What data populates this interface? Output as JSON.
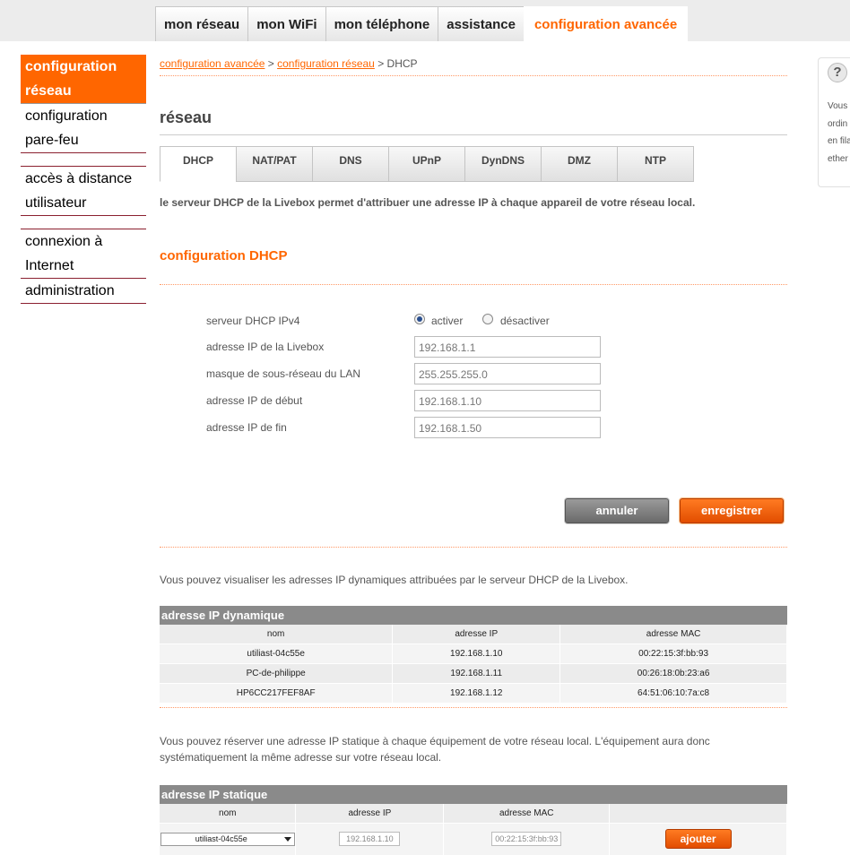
{
  "topnav": [
    "mon réseau",
    "mon WiFi",
    "mon téléphone",
    "assistance",
    "configuration avancée"
  ],
  "leftnav": {
    "item1": [
      "configuration",
      "réseau"
    ],
    "item2": [
      "configuration",
      "pare-feu"
    ],
    "item3": [
      "accès à distance",
      "utilisateur"
    ],
    "item4": [
      "connexion à",
      "Internet"
    ],
    "item5": "administration"
  },
  "breadcrumb": {
    "link1": "configuration avancée",
    "sep": " > ",
    "link2": "configuration réseau",
    "current": " > DHCP"
  },
  "help": {
    "icon": "?",
    "lines": [
      "Vous",
      "ordin",
      "en fila",
      "ether"
    ]
  },
  "page_title": "réseau",
  "subtabs": [
    "DHCP",
    "NAT/PAT",
    "DNS",
    "UPnP",
    "DynDNS",
    "DMZ",
    "NTP"
  ],
  "intro": "le serveur DHCP de la Livebox permet d'attribuer une adresse IP à chaque appareil de votre réseau local.",
  "section_title": "configuration DHCP",
  "form": {
    "dhcp_label": "serveur DHCP IPv4",
    "activer": "activer",
    "desactiver": "désactiver",
    "ip_label": "adresse IP de la Livebox",
    "ip_value": "192.168.1.1",
    "mask_label": "masque de sous-réseau du LAN",
    "mask_value": "255.255.255.0",
    "start_label": "adresse IP de début",
    "start_value": "192.168.1.10",
    "end_label": "adresse IP de fin",
    "end_value": "192.168.1.50"
  },
  "buttons": {
    "cancel": "annuler",
    "save": "enregistrer",
    "add": "ajouter"
  },
  "dyn_text": "Vous pouvez visualiser les adresses IP dynamiques attribuées par le serveur DHCP de la Livebox.",
  "dyn_table": {
    "title": "adresse IP dynamique",
    "headers": [
      "nom",
      "adresse IP",
      "adresse MAC"
    ],
    "rows": [
      [
        "utiliast-04c55e",
        "192.168.1.10",
        "00:22:15:3f:bb:93"
      ],
      [
        "PC-de-philippe",
        "192.168.1.11",
        "00:26:18:0b:23:a6"
      ],
      [
        "HP6CC217FEF8AF",
        "192.168.1.12",
        "64:51:06:10:7a:c8"
      ]
    ]
  },
  "static_text": [
    "Vous pouvez réserver une adresse IP statique à chaque équipement de votre réseau local. L'équipement aura donc",
    "systématiquement la même adresse sur votre réseau local."
  ],
  "static_table": {
    "title": "adresse IP statique",
    "headers": [
      "nom",
      "adresse IP",
      "adresse MAC"
    ],
    "select_value": "utiliast-04c55e",
    "ip_value": "192.168.1.10",
    "mac_value": "00:22:15:3f:bb:93"
  }
}
